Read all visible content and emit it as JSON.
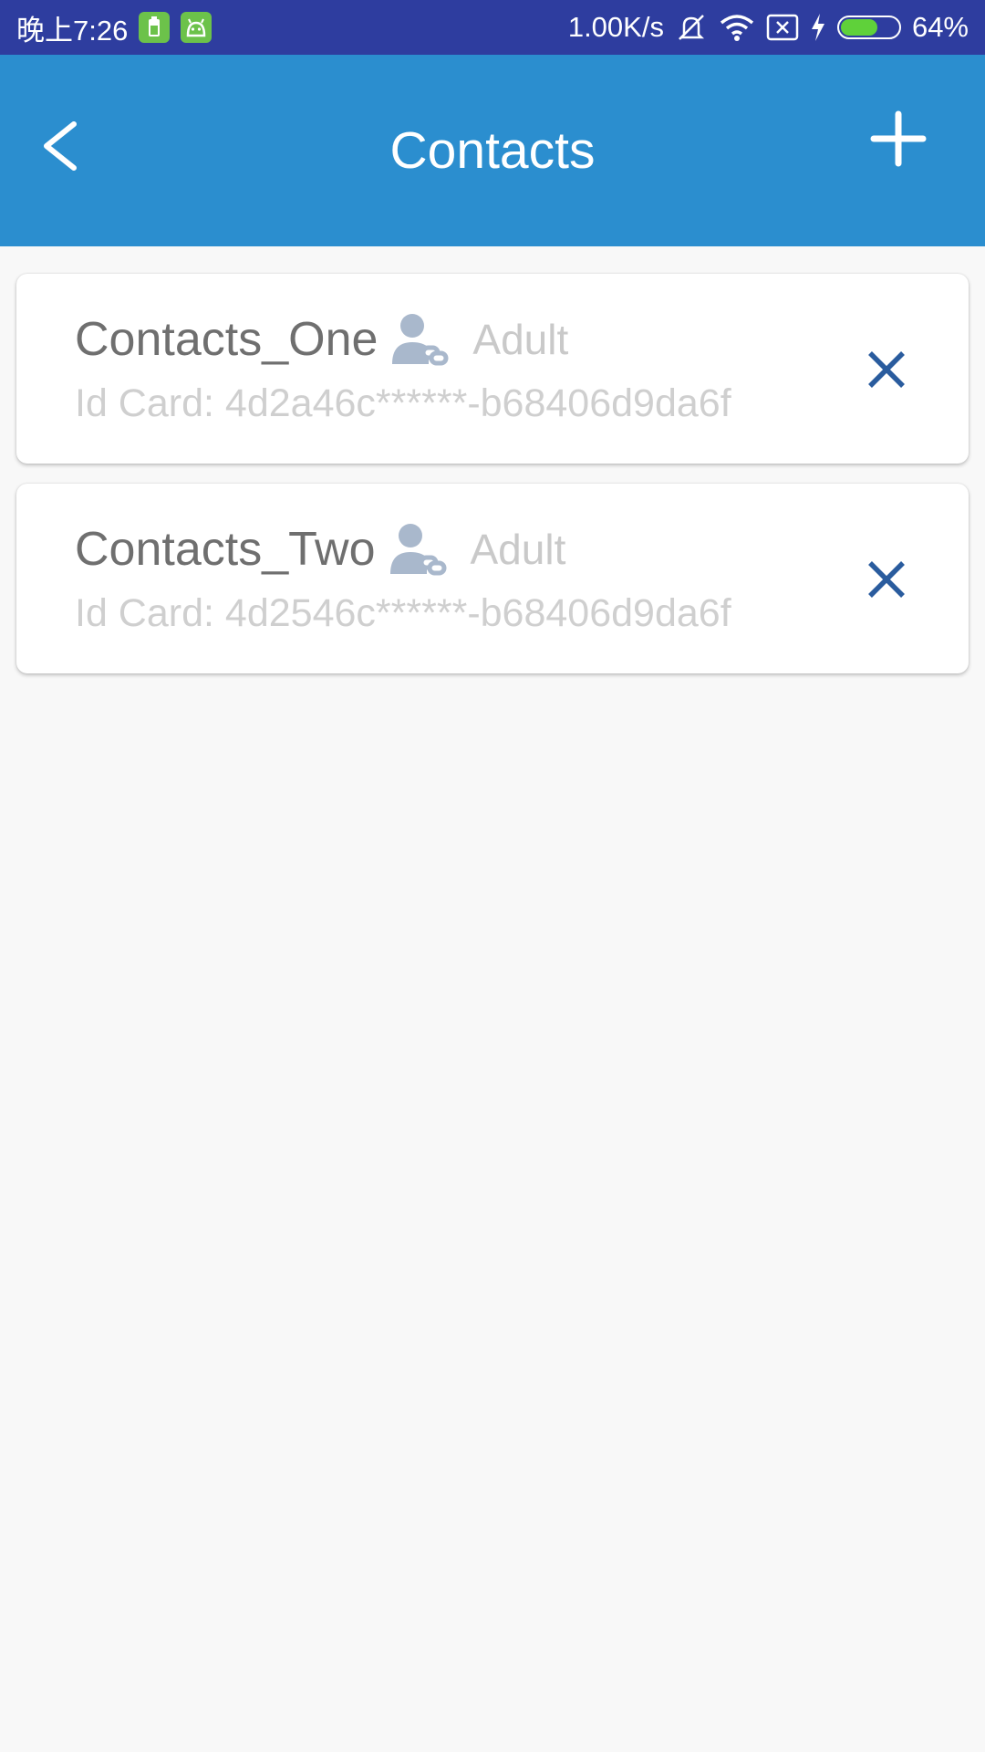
{
  "status_bar": {
    "time": "晚上7:26",
    "speed": "1.00K/s",
    "battery_percent": "64%",
    "battery_level": 0.64,
    "bg_color": "#2e3d9f",
    "icons": [
      "battery-app-icon",
      "android-app-icon",
      "mute-icon",
      "wifi-icon",
      "no-sim-icon",
      "charging-icon",
      "battery-icon"
    ]
  },
  "header": {
    "title": "Contacts",
    "back_icon": "chevron-left-icon",
    "add_icon": "plus-icon",
    "bg_color": "#2b8ecf"
  },
  "contacts": [
    {
      "name": "Contacts_One",
      "type": "Adult",
      "id_label": "Id Card:",
      "id_value": "4d2a46c******-b68406d9da6f"
    },
    {
      "name": "Contacts_Two",
      "type": "Adult",
      "id_label": "Id Card:",
      "id_value": "4d2546c******-b68406d9da6f"
    }
  ],
  "colors": {
    "accent_delete": "#2a5c9e",
    "person_icon": "#a9b8cc"
  }
}
